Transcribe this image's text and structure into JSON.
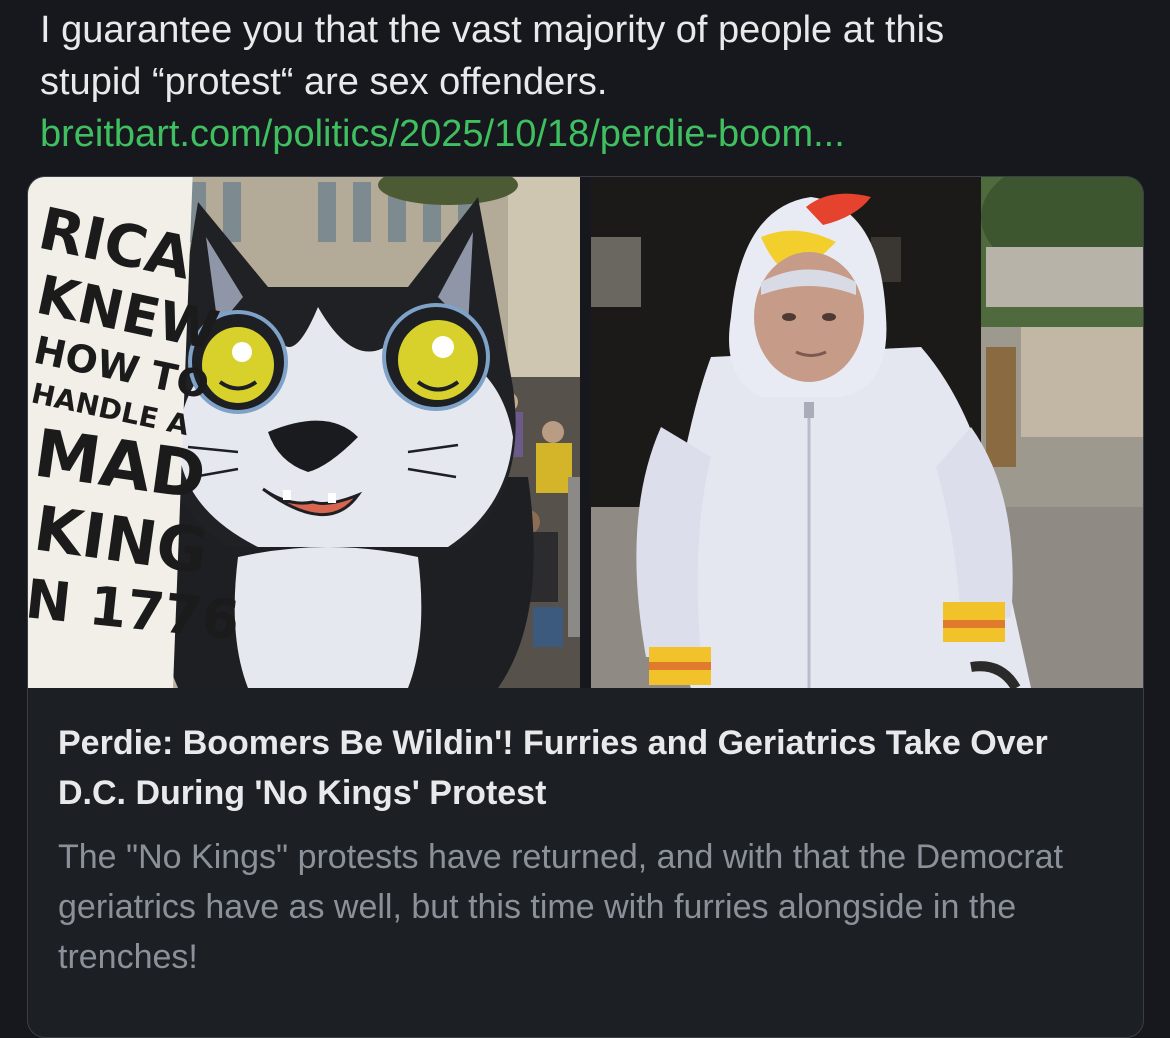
{
  "post": {
    "text": "I guarantee you that the vast majority of people at this\nstupid “protest“ are sex offenders.",
    "link": "breitbart.com/politics/2025/10/18/perdie-boom..."
  },
  "card": {
    "title": "Perdie: Boomers Be Wildin'! Furries and Geriatrics Take Over D.C. During 'No Kings' Protest",
    "description": "The \"No Kings\" protests have returned, and with that the Democrat geriatrics have as well, but this time with furries alongside in the trenches!",
    "sign_lines": [
      "RICA",
      "KNEW",
      "HOW TO",
      "HANDLE A",
      "MAD",
      "KING",
      "N 1776"
    ]
  },
  "colors": {
    "background": "#16181d",
    "link": "#3fbf5f",
    "text": "#e7e9ea",
    "muted": "#8b9199"
  }
}
